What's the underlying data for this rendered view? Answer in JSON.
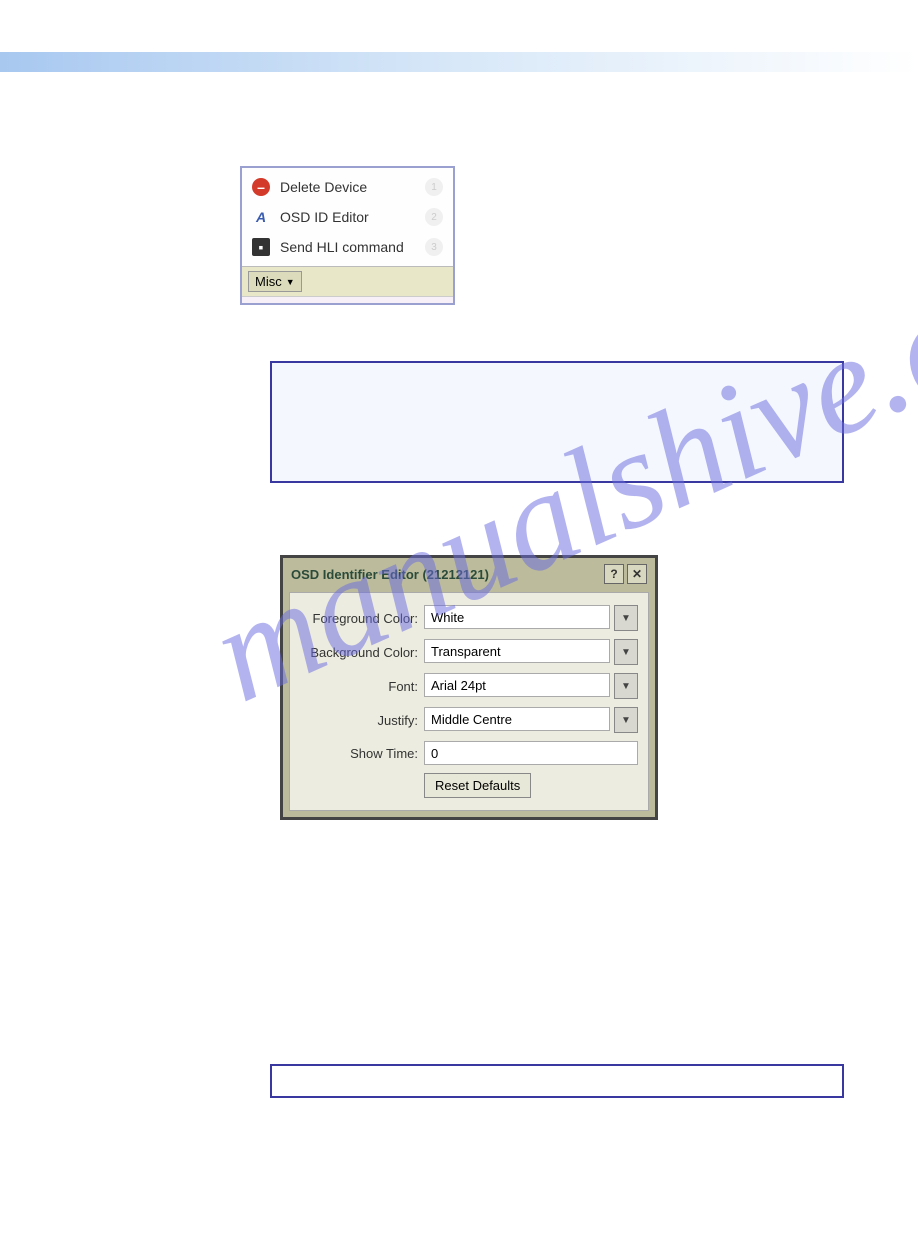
{
  "menu": {
    "items": [
      {
        "label": "Delete Device",
        "icon": "delete",
        "marker": "1"
      },
      {
        "label": "OSD ID Editor",
        "icon": "osd",
        "marker": "2"
      },
      {
        "label": "Send HLI command",
        "icon": "cmd",
        "marker": "3"
      }
    ],
    "footer_button": "Misc"
  },
  "dialog": {
    "title": "OSD Identifier Editor (21212121)",
    "fields": {
      "foreground": {
        "label": "Foreground Color:",
        "value": "White"
      },
      "background": {
        "label": "Background Color:",
        "value": "Transparent"
      },
      "font": {
        "label": "Font:",
        "value": "Arial 24pt"
      },
      "justify": {
        "label": "Justify:",
        "value": "Middle Centre"
      },
      "showtime": {
        "label": "Show Time:",
        "value": "0"
      }
    },
    "reset_button": "Reset Defaults"
  }
}
